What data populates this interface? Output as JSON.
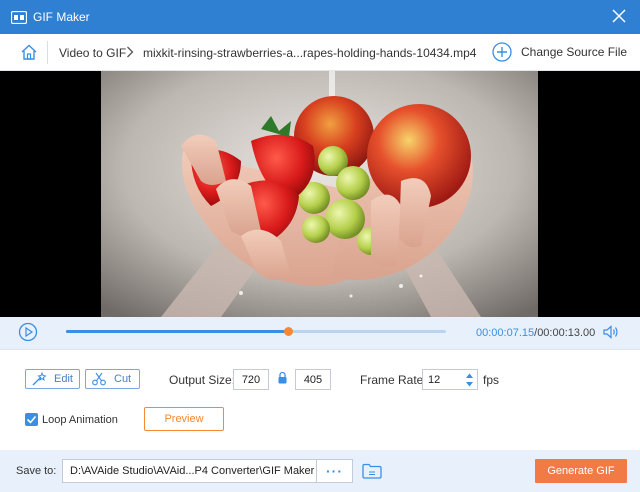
{
  "window": {
    "title": "GIF Maker",
    "title_bar_color": "#2f7fd3"
  },
  "icons": {
    "app": "gif-maker-logo",
    "close": "close-x",
    "home": "home",
    "chevron": "chevron-right",
    "add_source": "plus-circle",
    "play": "play-circle",
    "volume": "speaker",
    "edit": "magic-wand",
    "cut": "scissors",
    "lock": "padlock",
    "folder": "folder"
  },
  "breadcrumb": {
    "section": "Video to GIF",
    "file": "mixkit-rinsing-strawberries-a...rapes-holding-hands-10434.mp4",
    "change_source_label": "Change Source File"
  },
  "video": {
    "description": "Hands holding strawberries, grapes and apples under running water"
  },
  "playback": {
    "current_time": "00:00:07.15",
    "separator": "/",
    "total_time": "00:00:13.00",
    "progress_fraction": 0.583
  },
  "settings": {
    "edit_label": "Edit",
    "cut_label": "Cut",
    "output_size_label": "Output Size:",
    "width": "720",
    "height": "405",
    "frame_rate_label": "Frame Rate:",
    "frame_rate": "12",
    "fps_unit": "fps",
    "loop_label": "Loop Animation",
    "loop_checked": true,
    "preview_label": "Preview"
  },
  "save": {
    "label": "Save to:",
    "path": "D:\\AVAide Studio\\AVAid...P4 Converter\\GIF Maker",
    "browse_label": "···",
    "generate_label": "Generate GIF"
  },
  "colors": {
    "accent_blue": "#3a8ee6",
    "accent_orange": "#f27b45",
    "panel_bg": "#e8f1fb"
  }
}
